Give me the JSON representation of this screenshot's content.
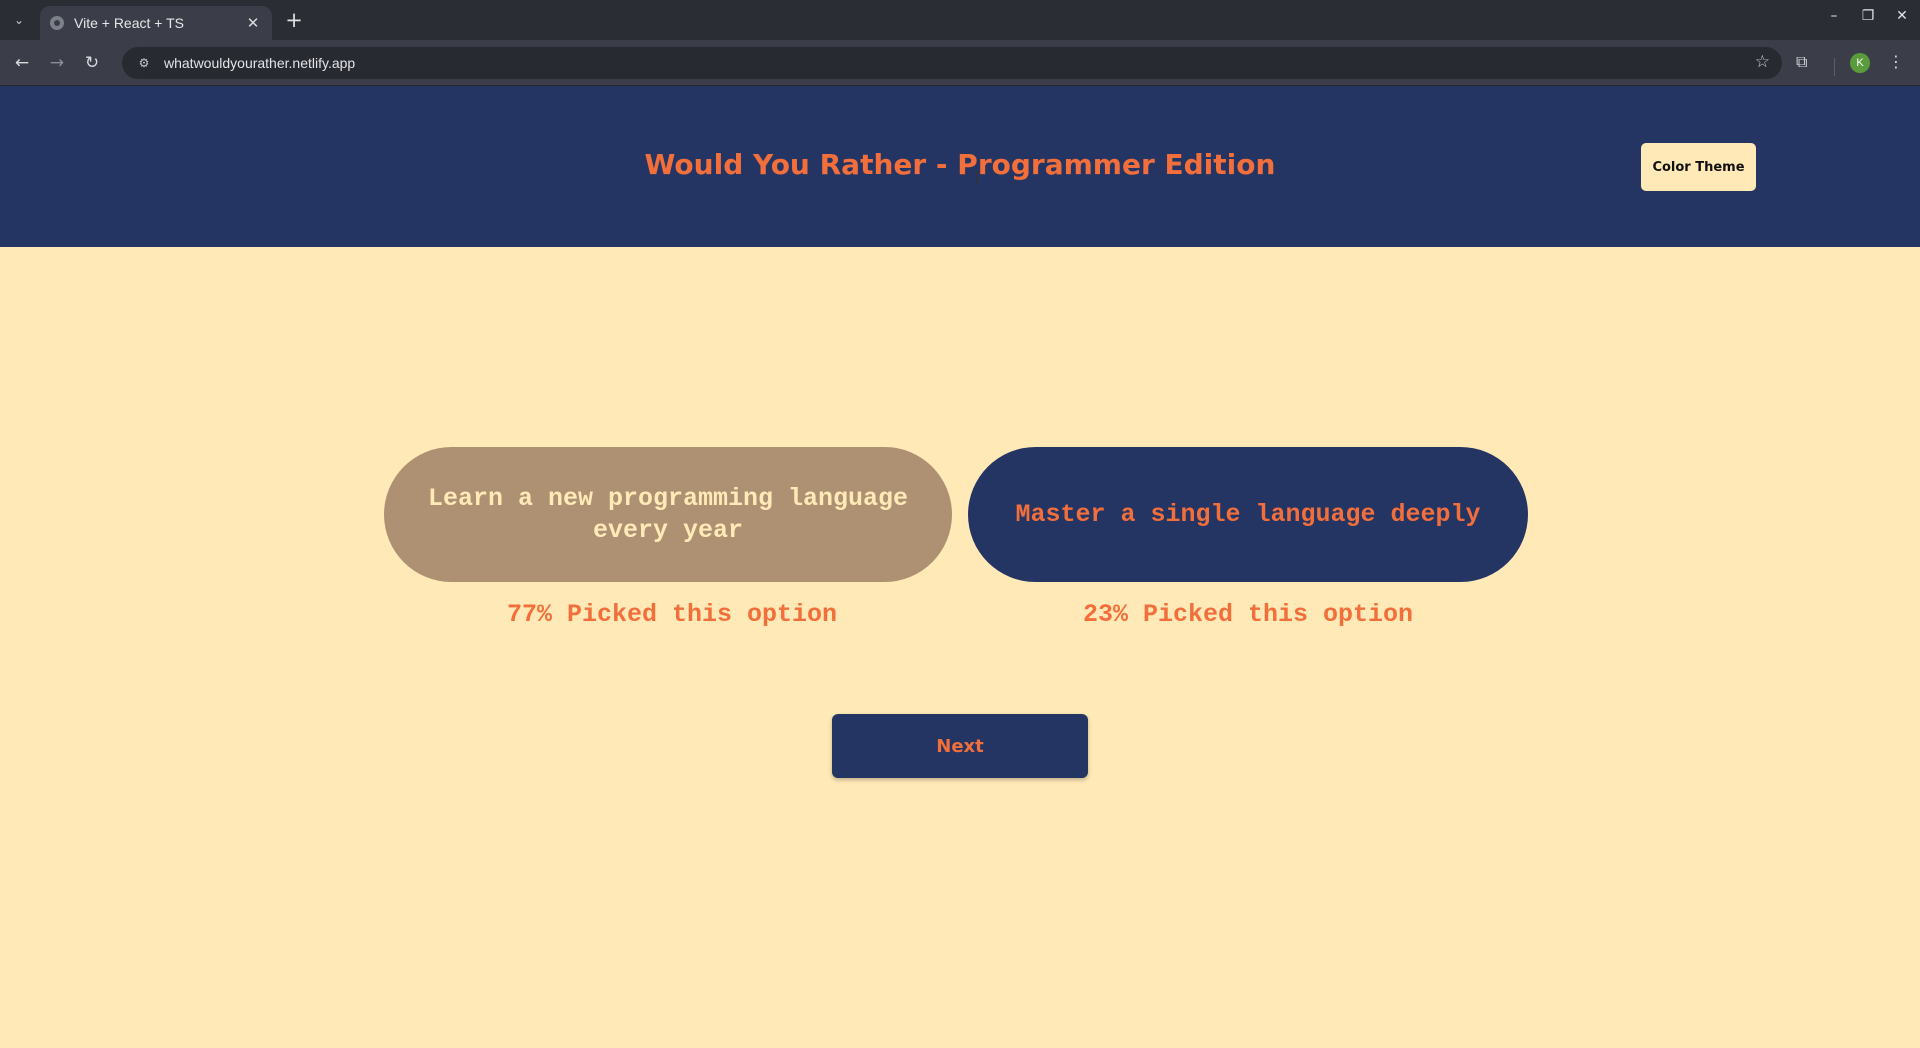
{
  "browser": {
    "tab": {
      "title": "Vite + React + TS"
    },
    "url": "whatwouldyourather.netlify.app",
    "profile_initial": "K",
    "icons": {
      "tab_search": "chevron-down-icon",
      "close": "close-icon",
      "new_tab": "plus-icon",
      "back": "back-arrow-icon",
      "forward": "forward-arrow-icon",
      "reload": "reload-icon",
      "site_info": "site-info-icon",
      "bookmark": "star-icon",
      "extensions": "puzzle-icon",
      "menu": "kebab-menu-icon"
    }
  },
  "header": {
    "title": "Would You Rather - Programmer Edition",
    "theme_button": "Color Theme"
  },
  "options": [
    {
      "text": "Learn a new programming language every year",
      "result": "77% Picked this option",
      "percent": 77
    },
    {
      "text": "Master a single language deeply",
      "result": "23% Picked this option",
      "percent": 23
    }
  ],
  "next_button": "Next",
  "colors": {
    "header_bg": "#253563",
    "accent": "#f26f3b",
    "page_bg": "#ffe9b7",
    "selected_option_bg": "#ae9072"
  }
}
